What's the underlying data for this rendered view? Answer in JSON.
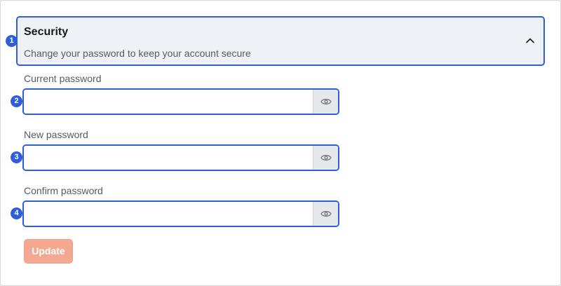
{
  "security_panel": {
    "title": "Security",
    "subtitle": "Change your password to keep your account secure",
    "toggle_icon": "chevron-up-icon"
  },
  "form": {
    "current_password": {
      "label": "Current password",
      "value": "",
      "toggle_icon": "eye-icon"
    },
    "new_password": {
      "label": "New password",
      "value": "",
      "toggle_icon": "eye-icon"
    },
    "confirm_password": {
      "label": "Confirm password",
      "value": "",
      "toggle_icon": "eye-icon"
    },
    "submit_label": "Update"
  },
  "markers": [
    "1",
    "2",
    "3",
    "4"
  ],
  "colors": {
    "accent": "#2f5fd8",
    "update_button": "#f4a892",
    "header_bg": "#eef2f6"
  }
}
